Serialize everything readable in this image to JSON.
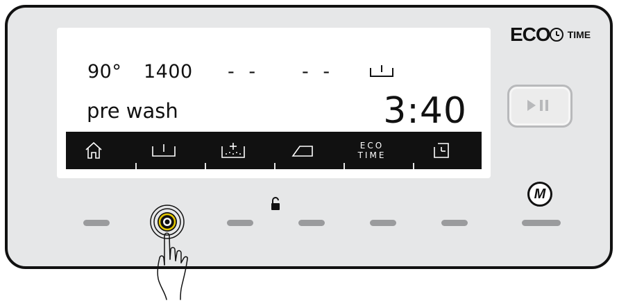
{
  "display": {
    "temperature": "90°",
    "spin": "1400",
    "option1": "- -",
    "option2": "- -",
    "program": "pre wash",
    "time": "3:40"
  },
  "menu_bar": {
    "items": [
      {
        "name": "home-icon"
      },
      {
        "name": "prewash-icon"
      },
      {
        "name": "stain-icon"
      },
      {
        "name": "iron-icon"
      },
      {
        "name": "eco-time",
        "line1": "ECO",
        "line2": "TIME"
      },
      {
        "name": "delay-timer-icon"
      }
    ]
  },
  "brand": {
    "eco": "ECO",
    "time_label": "TIME"
  },
  "buttons": {
    "start_pause": "start-pause-icon",
    "menu": "M"
  },
  "colors": {
    "panel": "#e6e7e8",
    "screen": "#ffffff",
    "bar": "#111111",
    "ring_highlight": "#e5c800",
    "key": "#9a9b9d"
  }
}
